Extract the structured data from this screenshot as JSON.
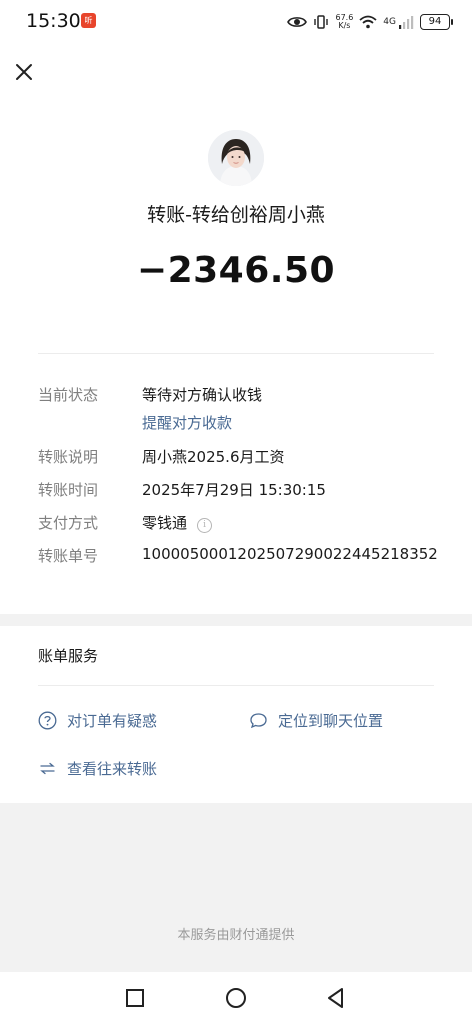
{
  "status_bar": {
    "time": "15:30",
    "app_badge": "听",
    "net_speed_value": "67.6",
    "net_speed_unit": "K/s",
    "network": "4G",
    "battery": "94"
  },
  "header": {
    "close_icon": "close-icon"
  },
  "payee": {
    "avatar_icon": "avatar-photo",
    "title": "转账-转给创裕周小燕",
    "amount": "−2346.50"
  },
  "details": {
    "status": {
      "label": "当前状态",
      "value": "等待对方确认收钱",
      "action": "提醒对方收款"
    },
    "note": {
      "label": "转账说明",
      "value": "周小燕2025.6月工资"
    },
    "time": {
      "label": "转账时间",
      "value": "2025年7月29日 15:30:15"
    },
    "method": {
      "label": "支付方式",
      "value": "零钱通"
    },
    "order": {
      "label": "转账单号",
      "value": "1000050001202507290022445218352"
    }
  },
  "services": {
    "title": "账单服务",
    "items": [
      {
        "label": "对订单有疑惑",
        "icon": "question-circle-icon"
      },
      {
        "label": "定位到聊天位置",
        "icon": "chat-bubble-icon"
      },
      {
        "label": "查看往来转账",
        "icon": "transfer-arrows-icon"
      }
    ]
  },
  "footer": {
    "text": "本服务由财付通提供"
  },
  "colors": {
    "link": "#4a6a93",
    "label": "#7f7f7f",
    "background": "#f2f2f2"
  }
}
